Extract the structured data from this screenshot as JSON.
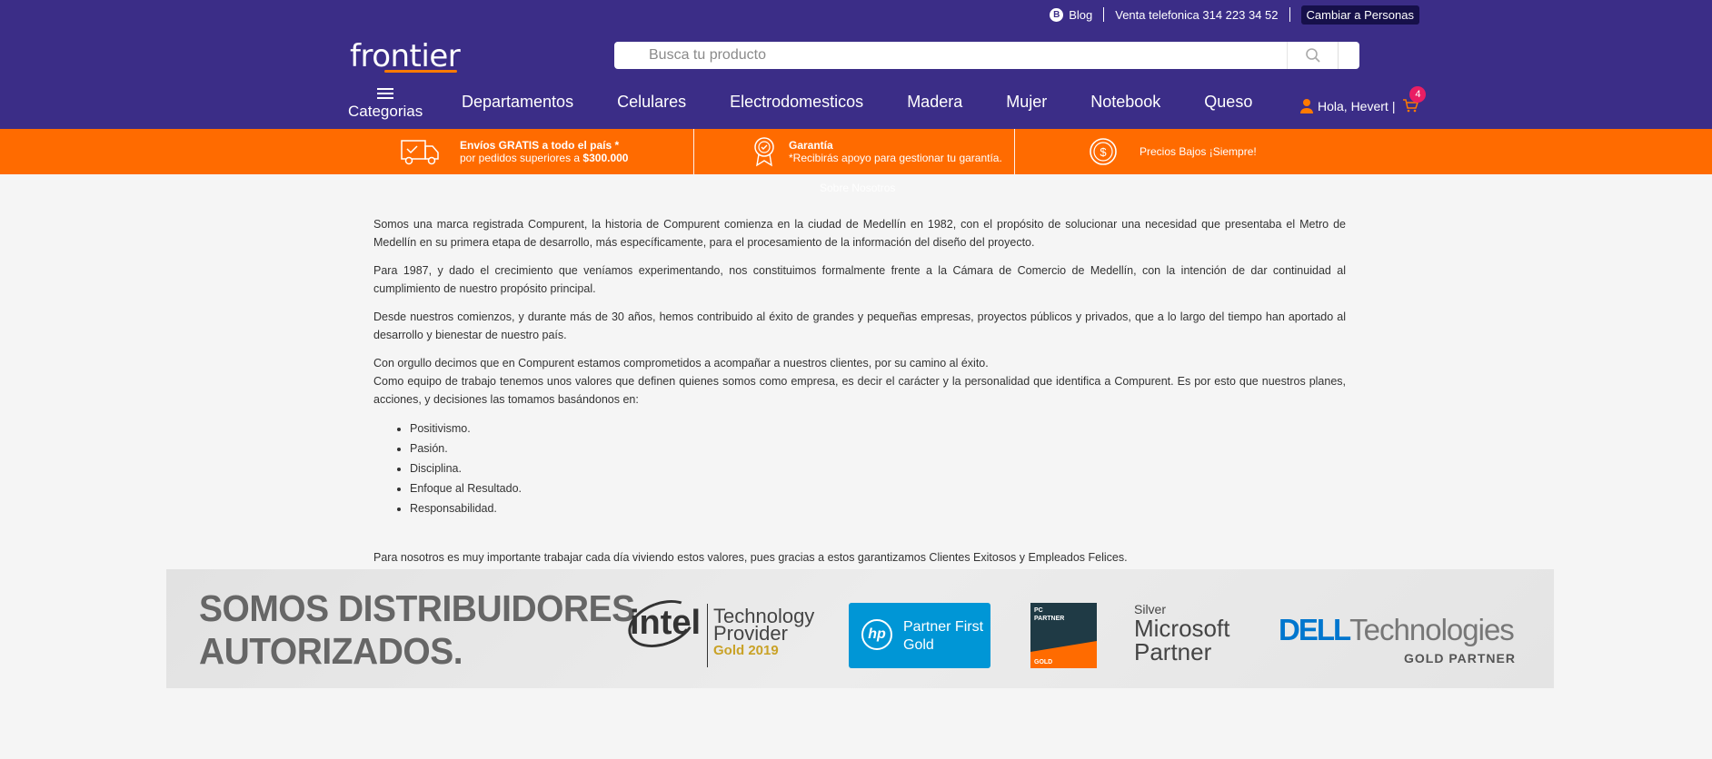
{
  "header": {
    "topbar": {
      "blog_label": "Blog",
      "phone_label": "Venta telefonica 314 223 34 52",
      "switch_label": "Cambiar a Personas"
    },
    "logo": "frontier",
    "search": {
      "placeholder": "Busca tu producto"
    },
    "categories_label": "Categorias",
    "nav_items": [
      "Departamentos",
      "Celulares",
      "Electrodomesticos",
      "Madera",
      "Mujer",
      "Notebook",
      "Queso"
    ],
    "user_greeting": "Hola, Hevert",
    "cart_count": "4"
  },
  "benefits": [
    {
      "line1": "Envíos GRATIS a todo el país *",
      "line2_pre": "por pedidos superiores a ",
      "line2_bold": "$300.000"
    },
    {
      "line1": "Garantía",
      "line2": "*Recibirás apoyo para gestionar tu garantía."
    },
    {
      "line1": "Precios Bajos ¡Siempre!"
    }
  ],
  "page_title": "Sobre Nosotros",
  "content": {
    "p1": "Somos una marca registrada Compurent, la historia de Compurent comienza en la ciudad de Medellín en 1982, con el propósito de solucionar una necesidad que presentaba el Metro de Medellín en su primera etapa de desarrollo, más específicamente, para el procesamiento de la información del diseño del proyecto.",
    "p2": "Para 1987, y dado el crecimiento que veníamos experimentando, nos constituimos formalmente frente a la Cámara de Comercio de Medellín, con la intención de dar continuidad al cumplimiento de nuestro propósito principal.",
    "p3": "Desde nuestros comienzos, y durante más de 30 años, hemos contribuido al éxito de grandes y pequeñas empresas, proyectos públicos y privados, que a lo largo del tiempo han aportado al desarrollo y bienestar de nuestro país.",
    "p4": "Con orgullo decimos que en Compurent estamos comprometidos a acompañar a nuestros clientes, por su camino al éxito.",
    "p5": "Como equipo de trabajo tenemos unos valores que definen quienes somos como empresa, es decir el carácter y la personalidad que identifica a Compurent. Es por esto que nuestros planes, acciones, y decisiones las tomamos basándonos en:",
    "values": [
      "Positivismo.",
      "Pasión.",
      "Disciplina.",
      "Enfoque al Resultado.",
      "Responsabilidad."
    ],
    "p6": "Para nosotros es muy importante trabajar cada día viviendo estos valores, pues gracias a estos garantizamos Clientes Exitosos y Empleados Felices."
  },
  "banner": {
    "title_line1": "SOMOS DISTRIBUIDORES",
    "title_line2": "AUTORIZADOS.",
    "intel": {
      "logo": "intel",
      "line1": "Technology",
      "line2": "Provider",
      "line3": "Gold 2019"
    },
    "hp": {
      "logo": "hp",
      "line1": "Partner First",
      "line2": "Gold"
    },
    "pc_partner": {
      "line1": "PC",
      "line2": "PARTNER",
      "line3": "GOLD"
    },
    "microsoft": {
      "line1": "Silver",
      "line2": "Microsoft",
      "line3": "Partner"
    },
    "dell": {
      "brand": "DELL",
      "tech": "Technologies",
      "tier": "GOLD PARTNER"
    }
  },
  "colors": {
    "header_bg": "#3b2d87",
    "benefits_bg": "#ff6b00",
    "accent": "#ff7a00"
  }
}
